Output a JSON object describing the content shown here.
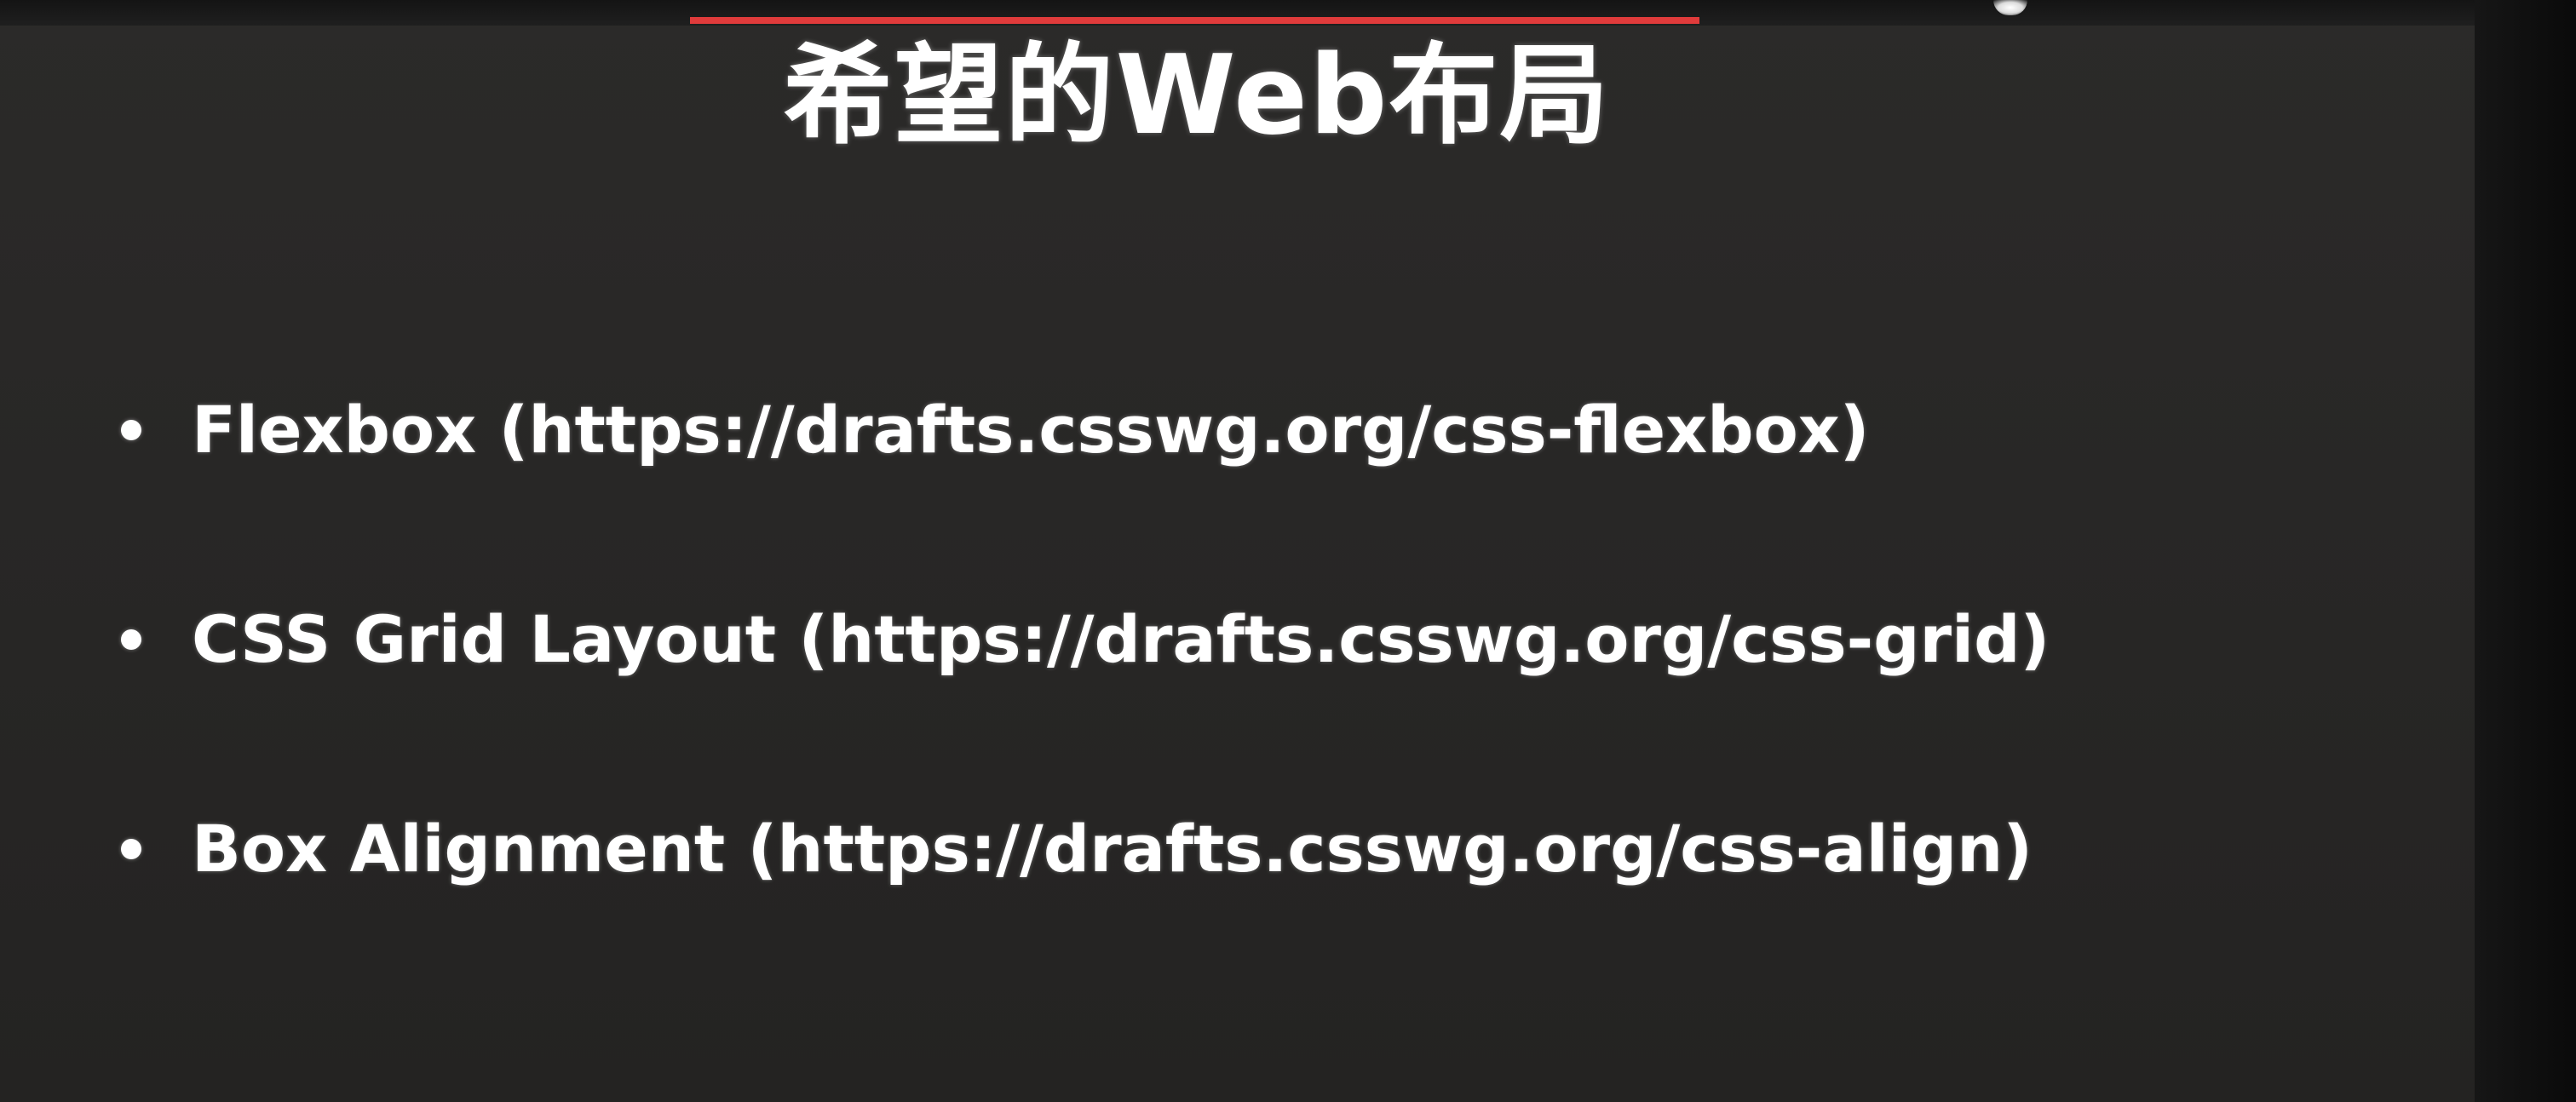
{
  "slide": {
    "title": "希望的Web布局",
    "bullets": [
      "Flexbox (https://drafts.csswg.org/css-flexbox)",
      "CSS Grid Layout (https://drafts.csswg.org/css-grid)",
      "Box Alignment (https://drafts.csswg.org/css-align)"
    ]
  },
  "colors": {
    "background": "#282726",
    "text": "#ffffff",
    "accent": "#e03b3b"
  }
}
